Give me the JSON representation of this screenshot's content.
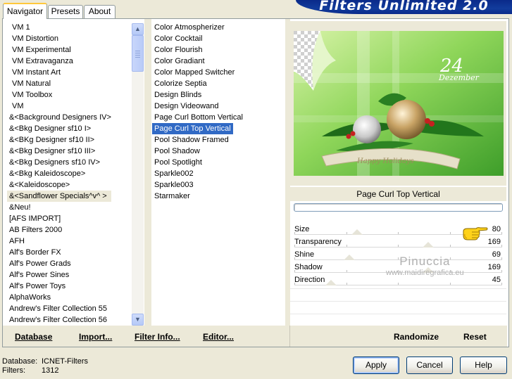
{
  "app": {
    "title": "Filters Unlimited 2.0"
  },
  "tabs": [
    {
      "label": "Navigator",
      "active": true
    },
    {
      "label": "Presets",
      "active": false
    },
    {
      "label": "About",
      "active": false
    }
  ],
  "categories": {
    "items": [
      "VM 1",
      "VM Distortion",
      "VM Experimental",
      "VM Extravaganza",
      "VM Instant Art",
      "VM Natural",
      "VM Toolbox",
      "VM",
      "&<Background Designers IV>",
      "&<Bkg Designer sf10 I>",
      "&<BKg Designer sf10 II>",
      "&<Bkg Designer sf10 III>",
      "&<Bkg Designers sf10 IV>",
      "&<Bkg Kaleidoscope>",
      "&<Kaleidoscope>",
      "&<Sandflower Specials^v^ >",
      "&Neu!",
      "[AFS IMPORT]",
      "AB Filters 2000",
      "AFH",
      "Alf's Border FX",
      "Alf's Power Grads",
      "Alf's Power Sines",
      "Alf's Power Toys",
      "AlphaWorks",
      "Andrew's Filter Collection 55",
      "Andrew's Filter Collection 56"
    ],
    "selected_index": 15
  },
  "filters": {
    "items": [
      "Color Atmospherizer",
      "Color Cocktail",
      "Color Flourish",
      "Color Gradiant",
      "Color Mapped Switcher",
      "Colorize Septia",
      "Design Blinds",
      "Design Videowand",
      "Page Curl Bottom Vertical",
      "Page Curl Top Vertical",
      "Pool Shadow Framed",
      "Pool Shadow",
      "Pool Spotlight",
      "Sparkle002",
      "Sparkle003",
      "Starmaker"
    ],
    "selected_index": 9
  },
  "preview": {
    "date_number": "24",
    "date_text": "Dezember",
    "banner_text": "Happy Holidays",
    "filter_name": "Page Curl Top Vertical",
    "progress": 0
  },
  "parameters": [
    {
      "label": "Size",
      "value": "80",
      "level": 0.31
    },
    {
      "label": "Transparency",
      "value": "169",
      "level": 0.66
    },
    {
      "label": "Shine",
      "value": "69",
      "level": 0.27
    },
    {
      "label": "Shadow",
      "value": "169",
      "level": 0.66
    },
    {
      "label": "Direction",
      "value": "45",
      "level": 0.18
    }
  ],
  "watermark": {
    "name": "Pinuccia",
    "site": "www.maidiregrafica.eu"
  },
  "links": {
    "database": "Database",
    "import": "Import...",
    "filter_info": "Filter Info...",
    "editor": "Editor...",
    "randomize": "Randomize",
    "reset": "Reset"
  },
  "status": {
    "database_label": "Database:",
    "database_value": "ICNET-Filters",
    "filters_label": "Filters:",
    "filters_value": "1312"
  },
  "buttons": {
    "apply": "Apply",
    "cancel": "Cancel",
    "help": "Help"
  },
  "colors": {
    "selection": "#316ac5",
    "banner": "#0a2a8a",
    "face": "#ece9d8"
  },
  "icons": {
    "hand": "pointing-hand-icon",
    "scroll_up": "chevron-up-icon",
    "scroll_down": "chevron-down-icon"
  }
}
